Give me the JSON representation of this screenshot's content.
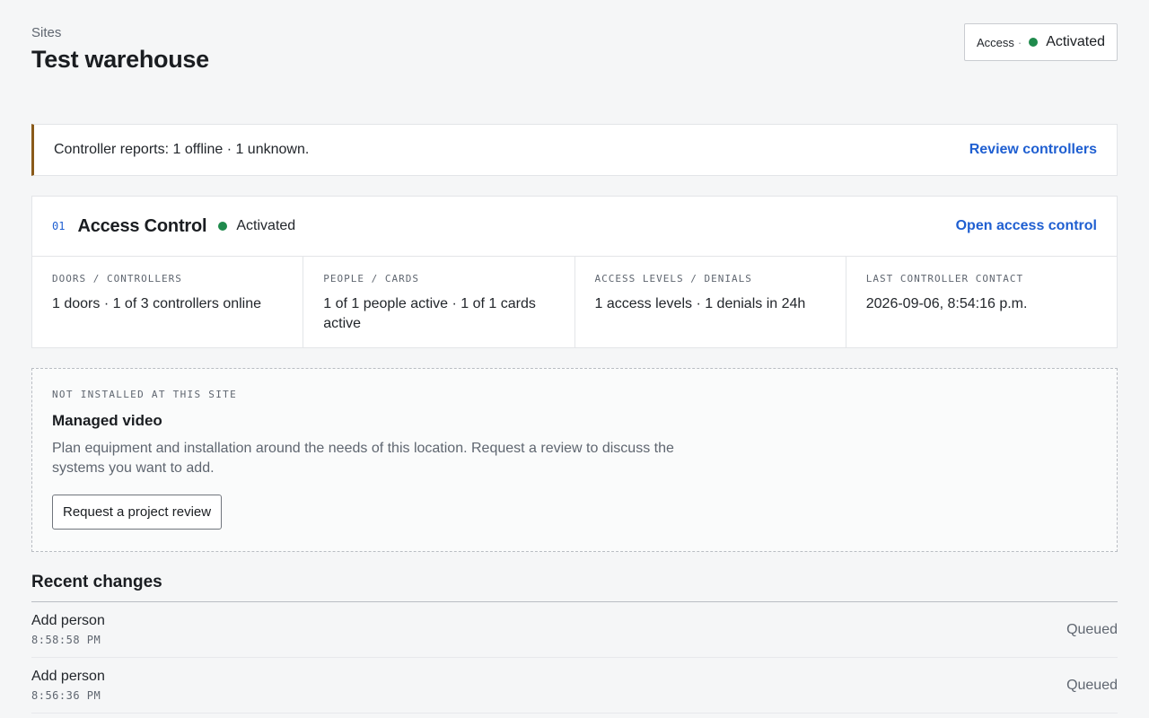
{
  "header": {
    "breadcrumb": "Sites",
    "title": "Test warehouse",
    "access_pill": {
      "label": "Access",
      "separator": "·",
      "status": "Activated"
    }
  },
  "alert": {
    "text": "Controller reports: 1 offline · 1 unknown.",
    "action": "Review controllers",
    "accent_color": "#8a5a1a"
  },
  "access_control": {
    "number": "01",
    "title": "Access Control",
    "status": "Activated",
    "status_color": "#1f8a4c",
    "action": "Open access control",
    "stats": [
      {
        "label": "DOORS / CONTROLLERS",
        "value": "1 doors · 1 of 3 controllers online"
      },
      {
        "label": "PEOPLE / CARDS",
        "value": "1 of 1 people active · 1 of 1 cards active"
      },
      {
        "label": "ACCESS LEVELS / DENIALS",
        "value": "1 access levels · 1 denials in 24h"
      },
      {
        "label": "LAST CONTROLLER CONTACT",
        "value": "2026-09-06, 8:54:16 p.m."
      }
    ]
  },
  "managed_video": {
    "eyebrow": "NOT INSTALLED AT THIS SITE",
    "title": "Managed video",
    "description": "Plan equipment and installation around the needs of this location. Request a review to discuss the systems you want to add.",
    "button": "Request a project review"
  },
  "recent_changes": {
    "title": "Recent changes",
    "items": [
      {
        "name": "Add person",
        "time": "8:58:58 PM",
        "status": "Queued"
      },
      {
        "name": "Add person",
        "time": "8:56:36 PM",
        "status": "Queued"
      }
    ]
  },
  "colors": {
    "link": "#1f5fd1",
    "activated": "#1f8a4c",
    "background": "#f5f6f7"
  }
}
